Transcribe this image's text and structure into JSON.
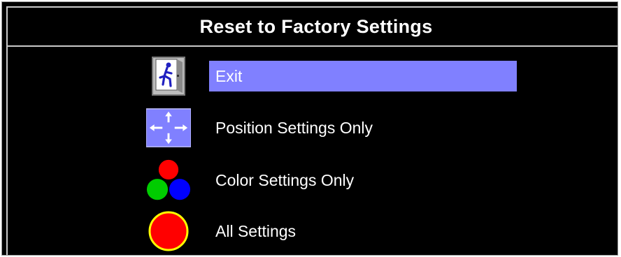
{
  "title": "Reset to Factory Settings",
  "menu": {
    "items": [
      {
        "label": "Exit",
        "icon": "exit-door-icon",
        "selected": true
      },
      {
        "label": "Position Settings Only",
        "icon": "position-arrows-icon",
        "selected": false
      },
      {
        "label": "Color Settings Only",
        "icon": "rgb-circles-icon",
        "selected": false
      },
      {
        "label": "All Settings",
        "icon": "red-circle-icon",
        "selected": false
      }
    ]
  },
  "colors": {
    "background": "#000000",
    "text": "#ffffff",
    "selection": "#8080ff",
    "frame": "#c9c9c9",
    "red": "#ff0000",
    "green": "#00cc00",
    "blue": "#0000ff",
    "yellow_ring": "#ffff00"
  }
}
